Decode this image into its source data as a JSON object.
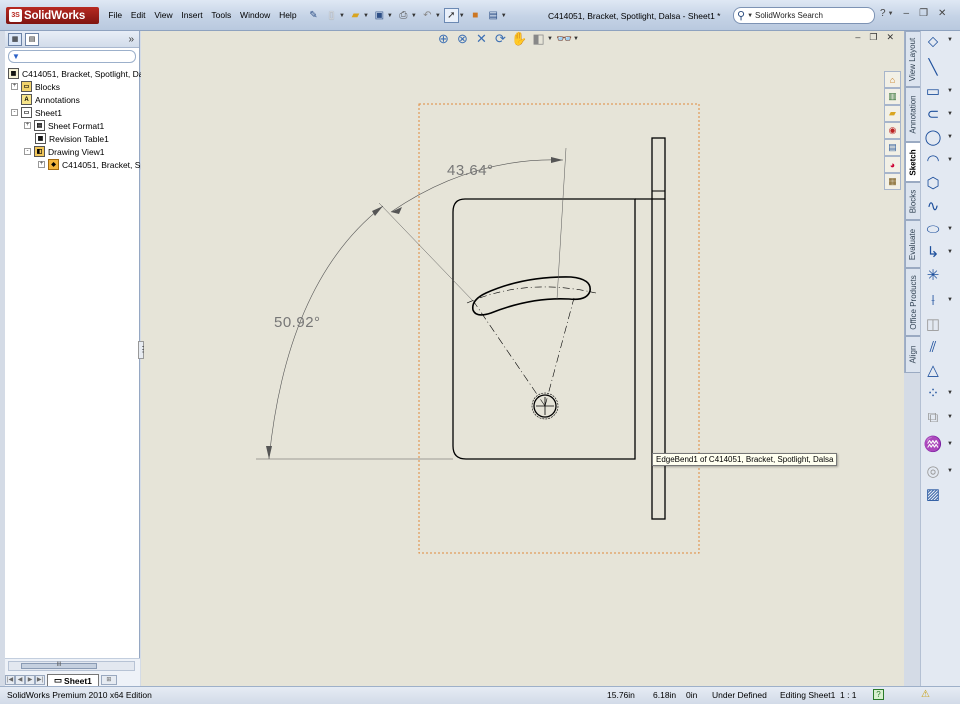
{
  "app": {
    "brand": "SolidWorks",
    "doc_title": "C414051, Bracket, Spotlight, Dalsa - Sheet1 *"
  },
  "menu": [
    "File",
    "Edit",
    "View",
    "Insert",
    "Tools",
    "Window",
    "Help"
  ],
  "search": {
    "placeholder": "SolidWorks Search"
  },
  "feature_tree": {
    "filter_icon": "funnel-icon",
    "root": "C414051, Bracket, Spotlight, Da",
    "items": [
      {
        "label": "Blocks",
        "icon": "folder-icon",
        "expand": "+"
      },
      {
        "label": "Annotations",
        "icon": "annotation-icon",
        "expand": ""
      },
      {
        "label": "Sheet1",
        "icon": "sheet-icon",
        "expand": "-"
      },
      {
        "label": "Sheet Format1",
        "icon": "sheet-format-icon",
        "expand": "+"
      },
      {
        "label": "Revision Table1",
        "icon": "table-icon",
        "expand": ""
      },
      {
        "label": "Drawing View1",
        "icon": "drawing-view-icon",
        "expand": "-"
      },
      {
        "label": "C414051, Bracket, Sp",
        "icon": "part-icon",
        "expand": "+"
      }
    ]
  },
  "sheet_tab": "Sheet1",
  "drawing": {
    "dimension_1": "43.64°",
    "dimension_2": "50.92°",
    "tooltip": "EdgeBend1 of C414051, Bracket, Spotlight, Dalsa"
  },
  "vertical_tabs": [
    "View Layout",
    "Annotation",
    "Sketch",
    "Blocks",
    "Evaluate",
    "Office Products",
    "Align"
  ],
  "active_tab": "Sketch",
  "status": {
    "edition": "SolidWorks Premium 2010 x64 Edition",
    "x": "15.76in",
    "y": "6.18in",
    "z": "0in",
    "state": "Under Defined",
    "editing": "Editing Sheet1",
    "scale": "1 : 1"
  },
  "colors": {
    "canvas": "#e6e4d8",
    "titlebar": "#c5d3e6",
    "view_boundary": "#e08a3c"
  }
}
